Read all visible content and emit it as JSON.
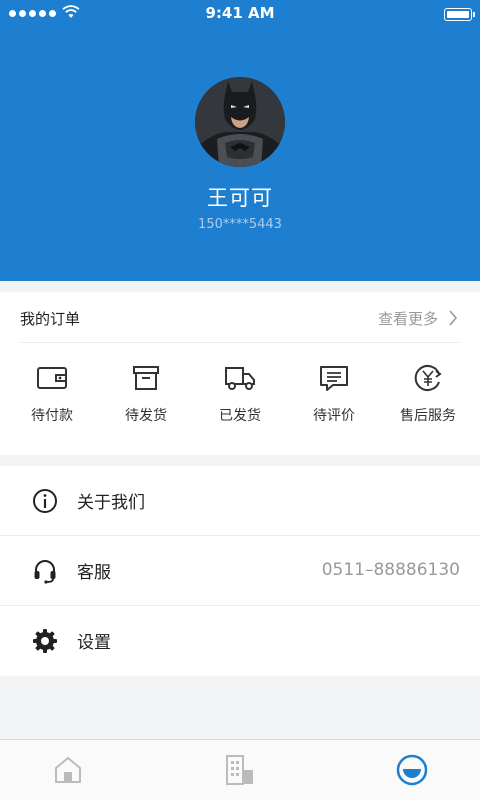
{
  "status_bar": {
    "time": "9:41 AM"
  },
  "profile": {
    "name": "王可可",
    "phone": "150****5443",
    "avatar": "batman-avatar"
  },
  "orders": {
    "title": "我的订单",
    "more_label": "查看更多",
    "items": [
      {
        "label": "待付款",
        "icon": "wallet-icon"
      },
      {
        "label": "待发货",
        "icon": "archive-box-icon"
      },
      {
        "label": "已发货",
        "icon": "truck-icon"
      },
      {
        "label": "待评价",
        "icon": "comment-icon"
      },
      {
        "label": "售后服务",
        "icon": "yen-refund-icon"
      }
    ]
  },
  "menu": [
    {
      "label": "关于我们",
      "icon": "info-icon",
      "value": ""
    },
    {
      "label": "客服",
      "icon": "headset-icon",
      "value": "0511–88886130"
    },
    {
      "label": "设置",
      "icon": "gear-icon",
      "value": ""
    }
  ],
  "tabbar": {
    "tabs": [
      {
        "icon": "home-icon",
        "active": false
      },
      {
        "icon": "building-icon",
        "active": false
      },
      {
        "icon": "smile-face-icon",
        "active": true
      }
    ],
    "active_color": "#1e7fd1",
    "inactive_color": "#bbbbbb"
  },
  "colors": {
    "primary": "#1e7fd1"
  }
}
